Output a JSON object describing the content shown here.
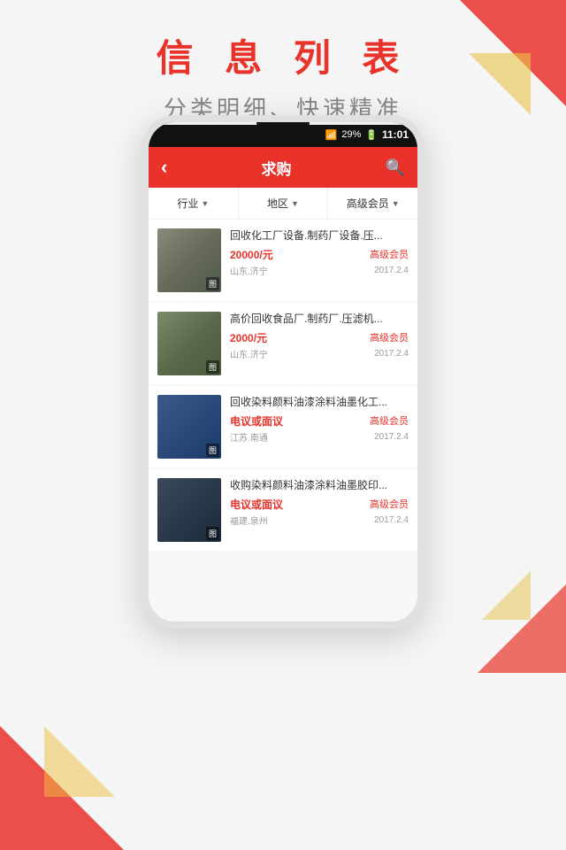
{
  "page": {
    "title": "信 息 列 表",
    "subtitle": "分类明细、快速精准"
  },
  "nav": {
    "back_icon": "‹",
    "title": "求购",
    "search_icon": "🔍"
  },
  "filters": [
    {
      "label": "行业",
      "arrow": "▼"
    },
    {
      "label": "地区",
      "arrow": "▼"
    },
    {
      "label": "高级会员",
      "arrow": "▼"
    }
  ],
  "items": [
    {
      "title": "回收化工厂设备.制药厂设备.压...",
      "price": "20000/元",
      "badge": "高级会员",
      "location": "山东.济宁",
      "date": "2017.2.4",
      "img_label": "图"
    },
    {
      "title": "高价回收食品厂.制药厂.压滤机...",
      "price": "2000/元",
      "badge": "高级会员",
      "location": "山东.济宁",
      "date": "2017.2.4",
      "img_label": "图"
    },
    {
      "title": "回收染料颜料油漆涂料油墨化工...",
      "price": "电议或面议",
      "badge": "高级会员",
      "location": "江苏.南通",
      "date": "2017.2.4",
      "img_label": "图"
    },
    {
      "title": "收购染料颜料油漆涂料油墨胶印...",
      "price": "电议或面议",
      "badge": "高级会员",
      "location": "福建.泉州",
      "date": "2017.2.4",
      "img_label": "图"
    }
  ],
  "status_bar": {
    "battery": "29%",
    "time": "11:01"
  }
}
